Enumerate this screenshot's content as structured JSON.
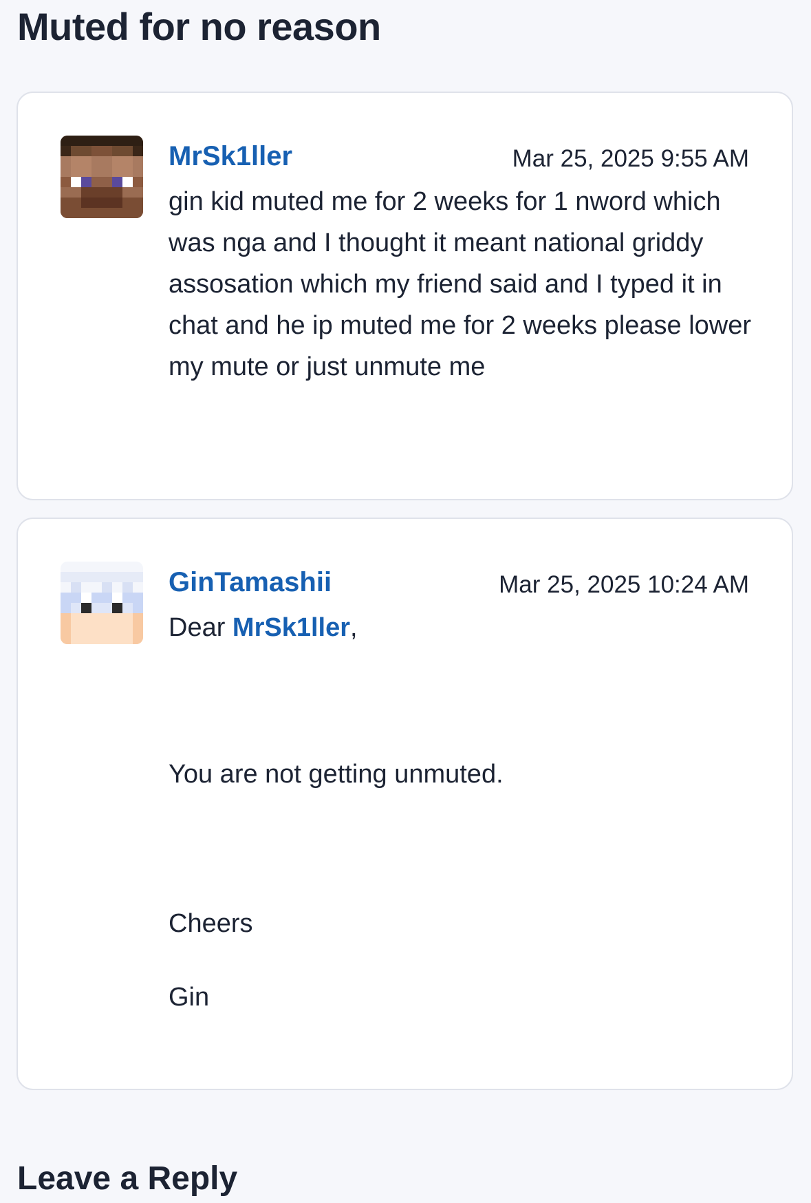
{
  "thread": {
    "title": "Muted for no reason"
  },
  "posts": [
    {
      "author": "MrSk1ller",
      "timestamp": "Mar 25, 2025 9:55 AM",
      "avatar_icon": "minecraft-skin-brown-hair-avatar-icon",
      "body": "gin kid muted me for 2 weeks for 1 nword which was nga and I thought it meant national griddy assosation which my friend said and I typed it in chat and he ip muted me for 2 weeks please lower my mute or just unmute me"
    },
    {
      "author": "GinTamashii",
      "timestamp": "Mar 25, 2025 10:24 AM",
      "avatar_icon": "minecraft-skin-white-hair-avatar-icon",
      "greeting_prefix": "Dear ",
      "mention": "MrSk1ller",
      "greeting_suffix": ",",
      "main_text": "You are not getting unmuted.",
      "closing": "Cheers",
      "signature": "Gin"
    }
  ],
  "reply": {
    "heading": "Leave a Reply"
  },
  "colors": {
    "background": "#f6f7fb",
    "card": "#ffffff",
    "card_border": "#dfe2ea",
    "link": "#1760b2",
    "text": "#1c2333"
  }
}
